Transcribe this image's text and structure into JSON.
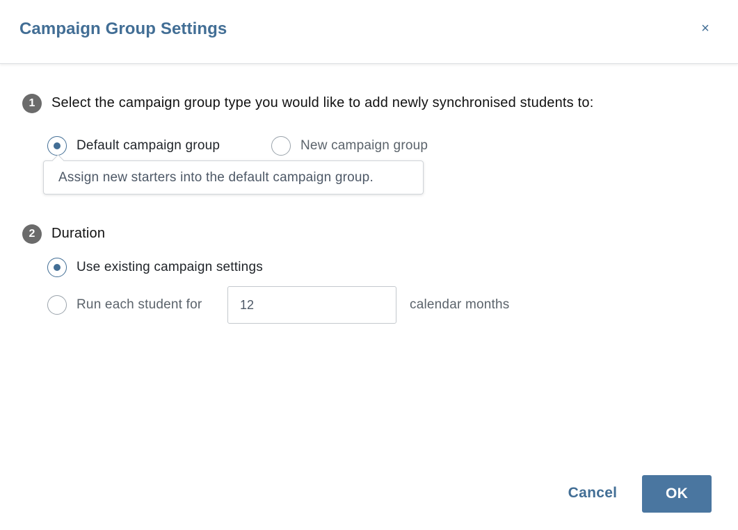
{
  "dialog": {
    "title": "Campaign Group Settings",
    "close_glyph": "×"
  },
  "steps": [
    {
      "number": "1",
      "label": "Select the campaign group type you would like to add newly synchronised students to:",
      "options": [
        {
          "label": "Default campaign group",
          "selected": true
        },
        {
          "label": "New campaign group",
          "selected": false
        }
      ],
      "tooltip": "Assign new starters into the default campaign group."
    },
    {
      "number": "2",
      "label": "Duration",
      "options": [
        {
          "label": "Use existing campaign settings",
          "selected": true
        },
        {
          "label": "Run each student for",
          "selected": false
        }
      ],
      "months_value": "12",
      "unit_label": "calendar months"
    }
  ],
  "buttons": {
    "cancel": "Cancel",
    "ok": "OK"
  },
  "colors": {
    "accent": "#426e95",
    "ok_button": "#4a76a0",
    "step_badge": "#6b6b6b"
  }
}
